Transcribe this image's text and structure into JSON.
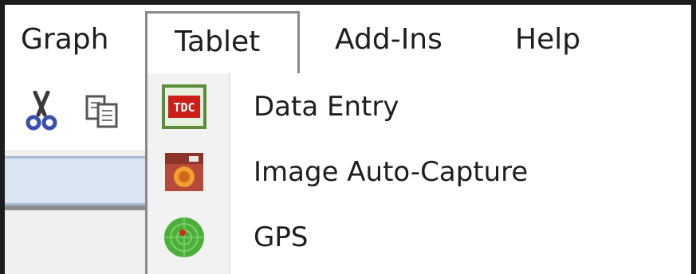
{
  "menubar": {
    "items": [
      {
        "label": "Graph"
      },
      {
        "label": "Tablet"
      },
      {
        "label": "Add-Ins"
      },
      {
        "label": "Help"
      }
    ],
    "active": "Tablet"
  },
  "toolbar": {
    "icons": [
      "scissors-icon",
      "copy-icon"
    ]
  },
  "dropdown": {
    "items": [
      {
        "label": "Data Entry",
        "icon": "tdc-icon",
        "icon_text": "TDC"
      },
      {
        "label": "Image Auto-Capture",
        "icon": "camera-icon"
      },
      {
        "label": "GPS",
        "icon": "gps-icon"
      }
    ]
  },
  "colors": {
    "tdc_red": "#cc1f1a",
    "tdc_border": "#5a8c3a",
    "gps_green": "#4caf3a",
    "strip_blue": "#dbe5f1"
  }
}
